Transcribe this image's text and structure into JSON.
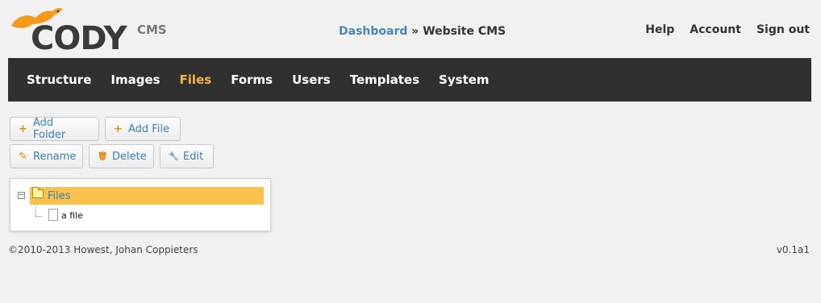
{
  "brand": {
    "logo_word": "CODY",
    "logo_sub": "CMS",
    "accent_color": "#f7b441",
    "nav_bg_color": "#303030",
    "link_color": "#3a80b4"
  },
  "breadcrumb": {
    "link": "Dashboard",
    "separator": " » ",
    "current": "Website CMS"
  },
  "topnav": {
    "help": "Help",
    "account": "Account",
    "sign_out": "Sign out"
  },
  "mainnav": {
    "items": [
      {
        "label": "Structure"
      },
      {
        "label": "Images"
      },
      {
        "label": "Files"
      },
      {
        "label": "Forms"
      },
      {
        "label": "Users"
      },
      {
        "label": "Templates"
      },
      {
        "label": "System"
      }
    ],
    "active": "Files"
  },
  "toolbar": {
    "add_folder": {
      "icon": "plus-icon",
      "glyph": "+",
      "label": "Add Folder"
    },
    "add_file": {
      "icon": "plus-icon",
      "glyph": "+",
      "label": "Add File"
    },
    "rename": {
      "icon": "pencil-icon",
      "glyph": "✎",
      "label": "Rename"
    },
    "delete": {
      "icon": "trash-icon",
      "glyph": "🗑",
      "label": "Delete"
    },
    "edit": {
      "icon": "wrench-icon",
      "glyph": "🔧",
      "label": "Edit"
    }
  },
  "tree": {
    "root": {
      "label": "Files",
      "icon": "folder-icon",
      "expander": "−"
    },
    "children": [
      {
        "label": "a file",
        "icon": "file-icon"
      }
    ]
  },
  "footer": {
    "copyright": "©2010-2013 Howest, Johan Coppieters",
    "version": "v0.1a1"
  }
}
